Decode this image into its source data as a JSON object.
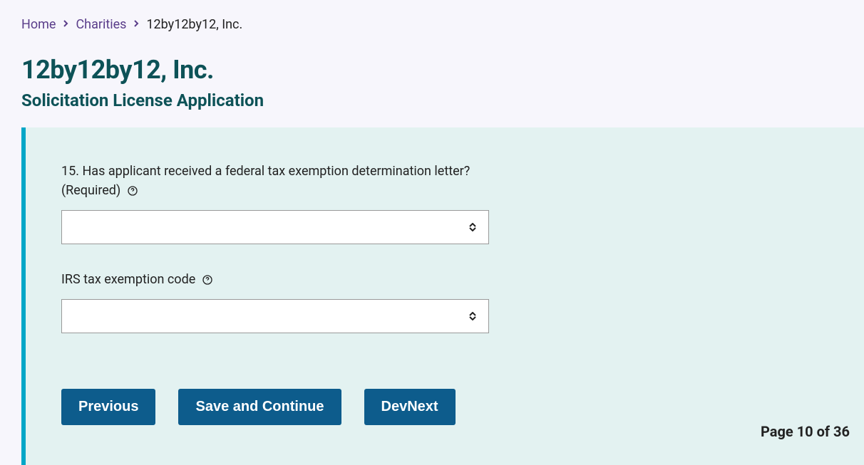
{
  "breadcrumb": {
    "home": "Home",
    "charities": "Charities",
    "current": "12by12by12, Inc."
  },
  "title": "12by12by12, Inc.",
  "subtitle": "Solicitation License Application",
  "form": {
    "question15": {
      "label": "15. Has applicant received a federal tax exemption determination letter?(Required)",
      "value": ""
    },
    "irsCode": {
      "label": "IRS tax exemption code",
      "value": ""
    }
  },
  "buttons": {
    "previous": "Previous",
    "saveContinue": "Save and Continue",
    "devNext": "DevNext"
  },
  "pageIndicator": "Page 10 of 36"
}
